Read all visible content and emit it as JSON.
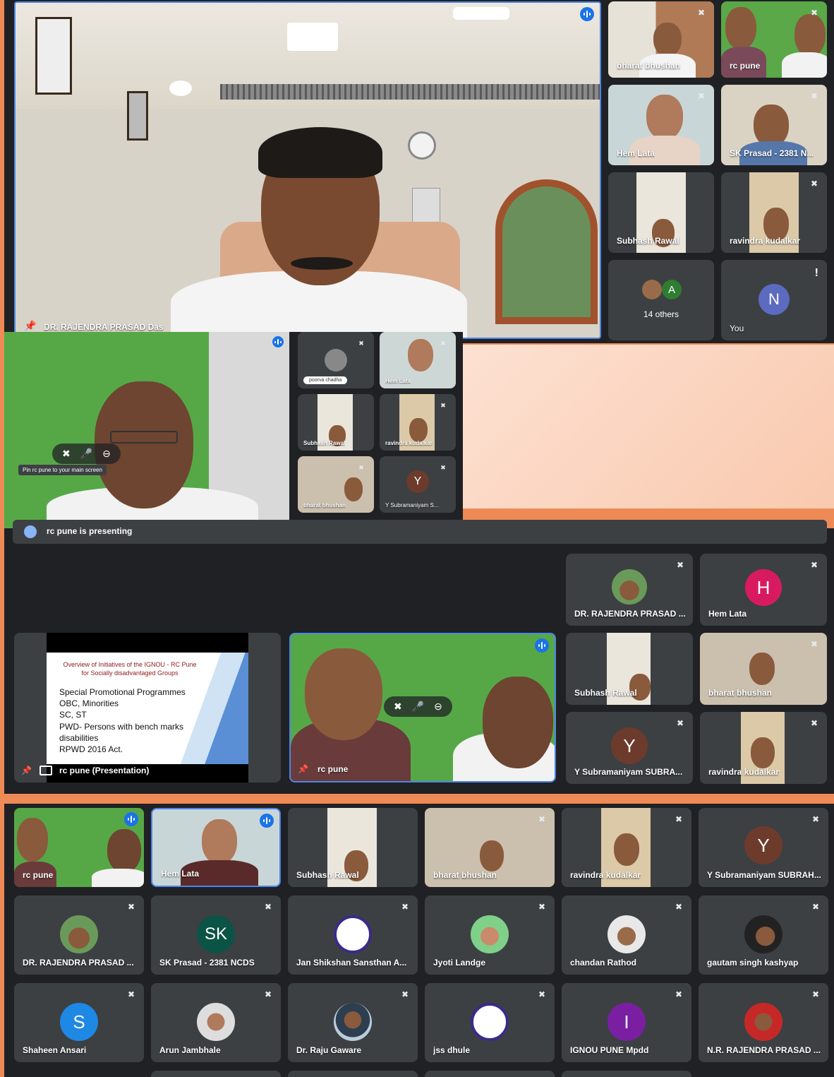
{
  "screenshot1": {
    "main": {
      "name": "DR. RAJENDRA PRASAD Das"
    },
    "side_tiles": [
      {
        "name": "bharat bhushan"
      },
      {
        "name": "rc pune"
      },
      {
        "name": "Hem Lata"
      },
      {
        "name": "SK Prasad - 2381 N..."
      },
      {
        "name": "Subhash Rawal"
      },
      {
        "name": "ravindra kudalkar"
      }
    ],
    "others": {
      "initial": "A",
      "label": "14 others"
    },
    "you": {
      "initial": "N",
      "label": "You",
      "alert": "!"
    }
  },
  "screenshot2": {
    "tooltip": "Pin rc pune to your main screen",
    "tiles": [
      {
        "name": "poorva chadha"
      },
      {
        "name": "Hem Lata"
      },
      {
        "name": "Subhash Rawal"
      },
      {
        "name": "ravindra kudalkar"
      },
      {
        "name": "bharat bhushan"
      },
      {
        "name": "Y Subramaniyam S...",
        "initial": "Y"
      }
    ]
  },
  "screenshot3": {
    "banner": "rc pune is presenting",
    "presentation": {
      "name": "rc pune (Presentation)",
      "slide_title": "Overview of Initiatives of  the IGNOU - RC Pune for Socially disadvantaged Groups",
      "bullets": [
        "Special Promotional Programmes",
        "OBC, Minorities",
        " SC, ST",
        "PWD- Persons with bench marks disabilities",
        "RPWD   2016 Act."
      ]
    },
    "pinned": {
      "name": "rc pune"
    },
    "tiles": [
      {
        "name": "DR. RAJENDRA PRASAD ..."
      },
      {
        "name": "Hem Lata",
        "initial": "H"
      },
      {
        "name": "Subhash Rawal"
      },
      {
        "name": "bharat bhushan"
      },
      {
        "name": "Y Subramaniyam SUBRA...",
        "initial": "Y"
      },
      {
        "name": "ravindra kudalkar"
      }
    ]
  },
  "screenshot4": {
    "rows": [
      [
        {
          "name": "rc pune"
        },
        {
          "name": "Hem Lata"
        },
        {
          "name": "Subhash Rawal"
        },
        {
          "name": "bharat bhushan"
        },
        {
          "name": "ravindra kudalkar"
        },
        {
          "name": "Y Subramaniyam SUBRAH...",
          "initial": "Y"
        }
      ],
      [
        {
          "name": "DR. RAJENDRA PRASAD ..."
        },
        {
          "name": "SK Prasad - 2381 NCDS",
          "initial": "SK"
        },
        {
          "name": "Jan Shikshan Sansthan A..."
        },
        {
          "name": "Jyoti Landge"
        },
        {
          "name": "chandan Rathod"
        },
        {
          "name": "gautam singh kashyap"
        }
      ],
      [
        {
          "name": "Shaheen Ansari",
          "initial": "S"
        },
        {
          "name": "Arun Jambhale"
        },
        {
          "name": "Dr. Raju Gaware"
        },
        {
          "name": "jss dhule"
        },
        {
          "name": "IGNOU PUNE Mpdd",
          "initial": "I"
        },
        {
          "name": "N.R. RAJENDRA PRASAD ..."
        }
      ]
    ]
  },
  "colors": {
    "background": "#ee8a55",
    "tile": "#3c4043",
    "panel": "#202124",
    "accent": "#1a73e8",
    "avatar_n": "#5c6bc0",
    "avatar_h": "#d81b60",
    "avatar_y": "#6d3b2c",
    "avatar_sk": "#0b5345",
    "avatar_s": "#1e88e5",
    "avatar_i": "#7b1fa2",
    "avatar_a": "#2e7d32"
  }
}
